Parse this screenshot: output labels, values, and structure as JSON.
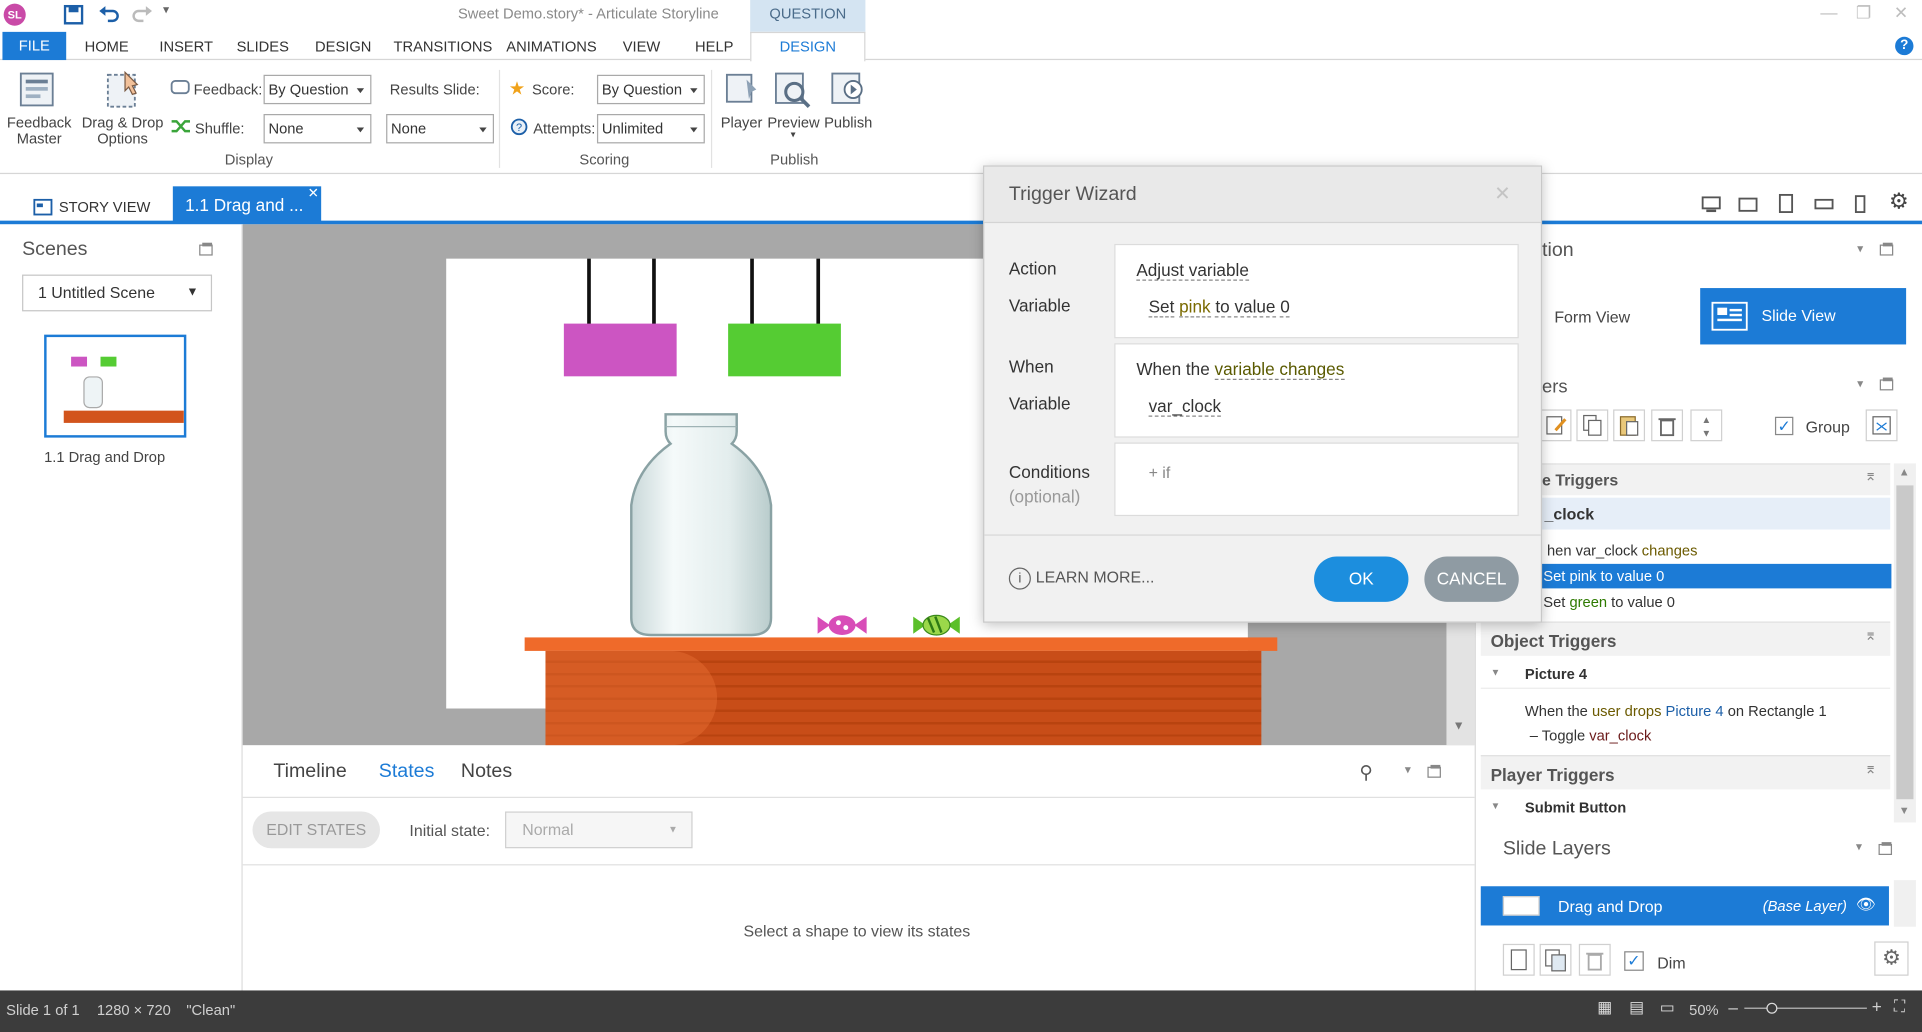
{
  "window": {
    "title": "Sweet Demo.story* - Articulate Storyline",
    "context_tab_header": "QUESTION TOOLS"
  },
  "app_badge": "SL",
  "ribbon_tabs": [
    "FILE",
    "HOME",
    "INSERT",
    "SLIDES",
    "DESIGN",
    "TRANSITIONS",
    "ANIMATIONS",
    "VIEW",
    "HELP",
    "DESIGN"
  ],
  "ribbon": {
    "feedback_master": "Feedback\nMaster",
    "feedback_master_l1": "Feedback",
    "feedback_master_l2": "Master",
    "dd_options_l1": "Drag & Drop",
    "dd_options_l2": "Options",
    "feedback_label": "Feedback:",
    "feedback_value": "By Question",
    "shuffle_label": "Shuffle:",
    "shuffle_value": "None",
    "results_label": "Results Slide:",
    "results_value": "None",
    "display_group": "Display",
    "score_label": "Score:",
    "score_value": "By Question",
    "attempts_label": "Attempts:",
    "attempts_value": "Unlimited",
    "scoring_group": "Scoring",
    "player": "Player",
    "preview": "Preview",
    "publish": "Publish",
    "publish_group": "Publish"
  },
  "view_tabs": {
    "story": "STORY VIEW",
    "slide": "1.1 Drag and ..."
  },
  "scenes": {
    "title": "Scenes",
    "dropdown": "1 Untitled Scene",
    "thumb_label": "1.1 Drag and Drop"
  },
  "bottom": {
    "tabs": [
      "Timeline",
      "States",
      "Notes"
    ],
    "active": "States",
    "edit_states": "EDIT STATES",
    "initial_state_label": "Initial state:",
    "initial_state_value": "Normal",
    "empty_msg": "Select a shape to view its states"
  },
  "right": {
    "header_partial": "tion",
    "form_view": "Form View",
    "slide_view": "Slide View",
    "triggers_partial": "ers",
    "group_label": "Group",
    "var_triggers_partial": "e Triggers",
    "var_clock_partial": "_clock",
    "when_line_partial": "hen var_clock ",
    "when_line_kw": "changes",
    "set_pink": "Set pink to value 0",
    "set_green_pre": "Set ",
    "set_green_kw": "green",
    "set_green_post": " to value 0",
    "object_triggers": "Object Triggers",
    "picture4": "Picture 4",
    "drop_line": {
      "pre": "When the ",
      "kw1": "user drops",
      "mid": " ",
      "kw2": "Picture 4",
      "mid2": " on Rectangle 1"
    },
    "toggle_pre": "Toggle ",
    "toggle_kw": "var_clock",
    "player_triggers": "Player Triggers",
    "submit_button": "Submit Button",
    "slide_layers": "Slide Layers",
    "layer_name": "Drag and Drop",
    "layer_base": "(Base Layer)",
    "dim_label": "Dim"
  },
  "status": {
    "slide": "Slide 1 of 1",
    "size": "1280 × 720",
    "theme": "\"Clean\"",
    "zoom": "50%"
  },
  "dialog": {
    "title": "Trigger Wizard",
    "action_label": "Action",
    "action_value": "Adjust variable",
    "variable_label": "Variable",
    "set_word": "Set",
    "pink_word": "pink",
    "to_value_word": "to value",
    "zero_word": "0",
    "when_label": "When",
    "when_pre": "When the ",
    "when_kw": "variable changes",
    "variable_label2": "Variable",
    "var_value": "var_clock",
    "conditions_label": "Conditions",
    "optional_label": "(optional)",
    "add_if": "+ if",
    "learn_more": "LEARN MORE...",
    "ok": "OK",
    "cancel": "CANCEL"
  },
  "colors": {
    "accent": "#1c7bd6",
    "ok": "#1c8ede",
    "cancel": "#8f9ba3",
    "pink": "#cc55c2",
    "green": "#55cc33",
    "table": "#d2541c"
  }
}
